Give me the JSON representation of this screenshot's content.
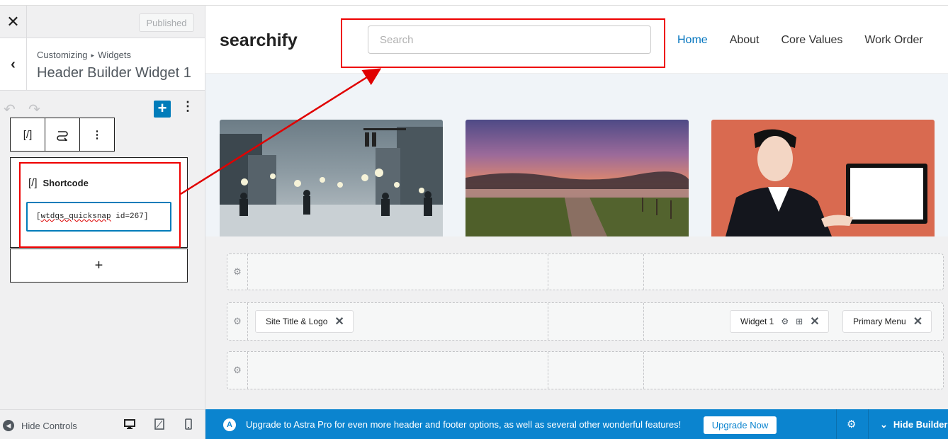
{
  "customizer": {
    "close_icon": "close-icon",
    "published_label": "Published",
    "breadcrumb": {
      "part1": "Customizing",
      "separator": "▸",
      "part2": "Widgets"
    },
    "section_title": "Header Builder Widget 1",
    "toolbar": {
      "undo_icon": "undo-icon",
      "redo_icon": "redo-icon",
      "add_label": "+",
      "options_icon": "⋮"
    },
    "block_toolbar": {
      "type_icon": "[/]",
      "transform_icon": "⥁",
      "more_icon": "⋮"
    },
    "shortcode_block": {
      "label": "Shortcode",
      "icon": "[/]",
      "value": "[wtdgs_quicksnap id=267]",
      "value_prefix": "[",
      "value_misspelled": "wtdgs_quicksnap",
      "value_suffix": " id=267]"
    },
    "add_block_label": "+",
    "footer": {
      "hide_controls_label": "Hide Controls"
    }
  },
  "site": {
    "title": "searchify",
    "search_placeholder": "Search",
    "nav": [
      {
        "label": "Home",
        "active": true
      },
      {
        "label": "About",
        "active": false
      },
      {
        "label": "Core Values",
        "active": false
      },
      {
        "label": "Work Order",
        "active": false
      }
    ]
  },
  "builder": {
    "row2_items": {
      "site_title_logo": "Site Title & Logo",
      "widget1": "Widget 1",
      "primary_menu": "Primary Menu"
    }
  },
  "upgrade_bar": {
    "message": "Upgrade to Astra Pro for even more header and footer options, as well as several other wonderful features!",
    "button_label": "Upgrade Now",
    "hide_builder_label": "Hide Builder"
  },
  "colors": {
    "accent": "#007cba",
    "link_active": "#0274be",
    "annotation_red": "#e00000",
    "upgrade_bar": "#0b84cf"
  }
}
